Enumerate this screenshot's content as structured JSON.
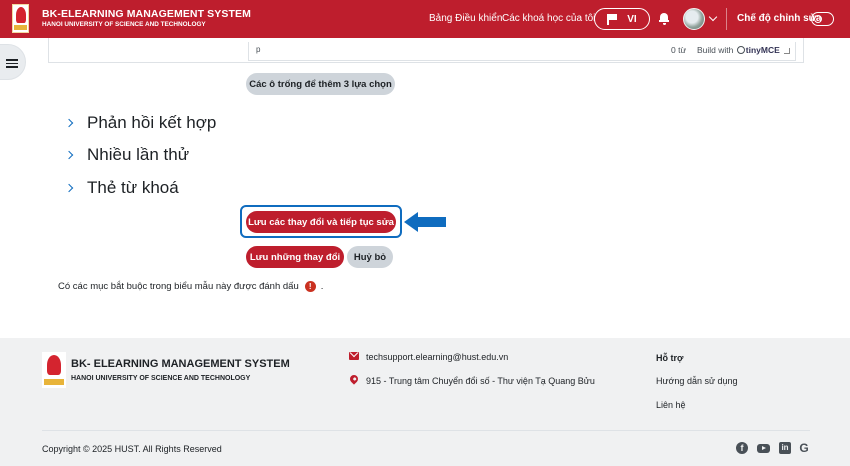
{
  "header": {
    "brand_title": "BK-ELEARNING MANAGEMENT SYSTEM",
    "brand_subtitle": "HANOI UNIVERSITY OF SCIENCE AND TECHNOLOGY",
    "links": [
      "Bảng Điều khiển",
      "Các khoá học của tôi"
    ],
    "language": "VI",
    "edit_mode_label": "Chế độ chỉnh sửa",
    "edit_mode_on": false
  },
  "editor": {
    "path": "p",
    "word_count": "0 từ",
    "built_with": "Build with",
    "tiny_brand": "tinyMCE"
  },
  "blanks_button": "Các ô trống để thêm 3 lựa chọn",
  "sections": [
    "Phản hồi kết hợp",
    "Nhiều lần thử",
    "Thẻ từ khoá"
  ],
  "actions": {
    "save_continue": "Lưu các thay đổi và tiếp tục sửa",
    "save": "Lưu những thay đổi",
    "cancel": "Huỷ bỏ"
  },
  "required_note": {
    "text": "Có các mục bắt buộc trong biểu mẫu này được đánh dấu",
    "suffix": ".",
    "icon": "required-icon"
  },
  "footer": {
    "brand_title": "BK- ELEARNING MANAGEMENT SYSTEM",
    "brand_subtitle": "HANOI UNIVERSITY OF SCIENCE AND TECHNOLOGY",
    "email": "techsupport.elearning@hust.edu.vn",
    "address": "915 - Trung tâm Chuyển đổi số - Thư viện Tạ Quang Bửu",
    "support_heading": "Hỗ trợ",
    "support_links": [
      "Hướng dẫn sử dụng",
      "Liên hệ"
    ],
    "copyright": "Copyright © 2025 HUST. All Rights Reserved",
    "social_icons": [
      "facebook-icon",
      "youtube-icon",
      "linkedin-icon",
      "google-icon"
    ]
  },
  "colors": {
    "brand_red": "#be1e2d",
    "accent_blue": "#0f6cbf",
    "footer_bg": "#f0f1f2"
  }
}
